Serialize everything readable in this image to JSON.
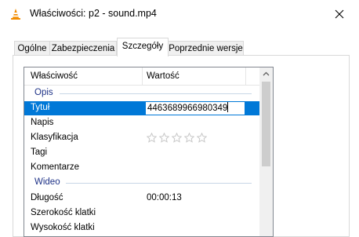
{
  "window": {
    "title": "Właściwości: p2 - sound.mp4",
    "app_icon": "vlc-cone-icon",
    "close_icon": "close-icon"
  },
  "tabs": [
    {
      "label": "Ogólne",
      "active": false
    },
    {
      "label": "Zabezpieczenia",
      "active": false
    },
    {
      "label": "Szczegóły",
      "active": true
    },
    {
      "label": "Poprzednie wersje",
      "active": false
    }
  ],
  "details": {
    "columns": {
      "property": "Właściwość",
      "value": "Wartość"
    },
    "groups": [
      {
        "label": "Opis",
        "rows": [
          {
            "name": "Tytuł",
            "value": "4463689966980349",
            "selected": true,
            "editing": true
          },
          {
            "name": "Napis",
            "value": ""
          },
          {
            "name": "Klasyfikacja",
            "rating": 0,
            "rating_max": 5
          },
          {
            "name": "Tagi",
            "value": ""
          },
          {
            "name": "Komentarze",
            "value": ""
          }
        ]
      },
      {
        "label": "Wideo",
        "rows": [
          {
            "name": "Długość",
            "value": "00:00:13"
          },
          {
            "name": "Szerokość klatki",
            "value": ""
          },
          {
            "name": "Wysokość klatki",
            "value": ""
          }
        ]
      }
    ]
  },
  "colors": {
    "selection": "#0078d7",
    "group_text": "#1e3287",
    "star": "#c8c8c8"
  }
}
